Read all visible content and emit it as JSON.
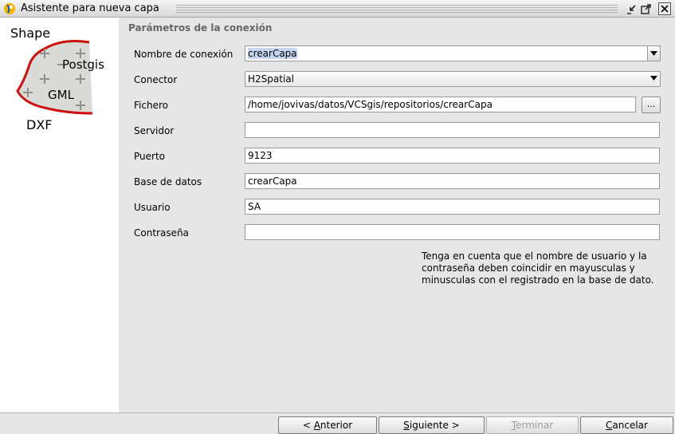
{
  "window": {
    "title": "Asistente para nueva capa",
    "controls": [
      "iconify-icon",
      "maximize-icon",
      "close-icon"
    ]
  },
  "sidebar": {
    "formats": [
      "Shape",
      "Postgis",
      "GML",
      "DXF"
    ]
  },
  "form": {
    "section_title": "Parámetros de la conexión",
    "fields": {
      "connection_name": {
        "label": "Nombre de conexión",
        "value": "crearCapa"
      },
      "connector": {
        "label": "Conector",
        "value": "H2Spatial"
      },
      "file": {
        "label": "Fichero",
        "value": "/home/jovivas/datos/VCSgis/repositorios/crearCapa",
        "browse_label": "..."
      },
      "server": {
        "label": "Servidor",
        "value": ""
      },
      "port": {
        "label": "Puerto",
        "value": "9123"
      },
      "database": {
        "label": "Base de datos",
        "value": "crearCapa"
      },
      "user": {
        "label": "Usuario",
        "value": "SA"
      },
      "password": {
        "label": "Contraseña",
        "value": ""
      }
    },
    "note": "Tenga en cuenta que el nombre de usuario y la contraseña deben coincidir en mayusculas y minusculas con el registrado en la base de dato."
  },
  "buttons": {
    "previous": {
      "prefix": "< ",
      "mnemonic": "A",
      "rest": "nterior"
    },
    "next": {
      "mnemonic": "S",
      "rest": "iguiente >"
    },
    "finish": {
      "mnemonic": "T",
      "rest": "erminar",
      "enabled": false
    },
    "cancel": {
      "mnemonic": "C",
      "rest": "ancelar"
    }
  },
  "colors": {
    "selection": "#c6d6f2",
    "logo_red": "#cc1111",
    "disabled_text": "#9a9a9a"
  }
}
